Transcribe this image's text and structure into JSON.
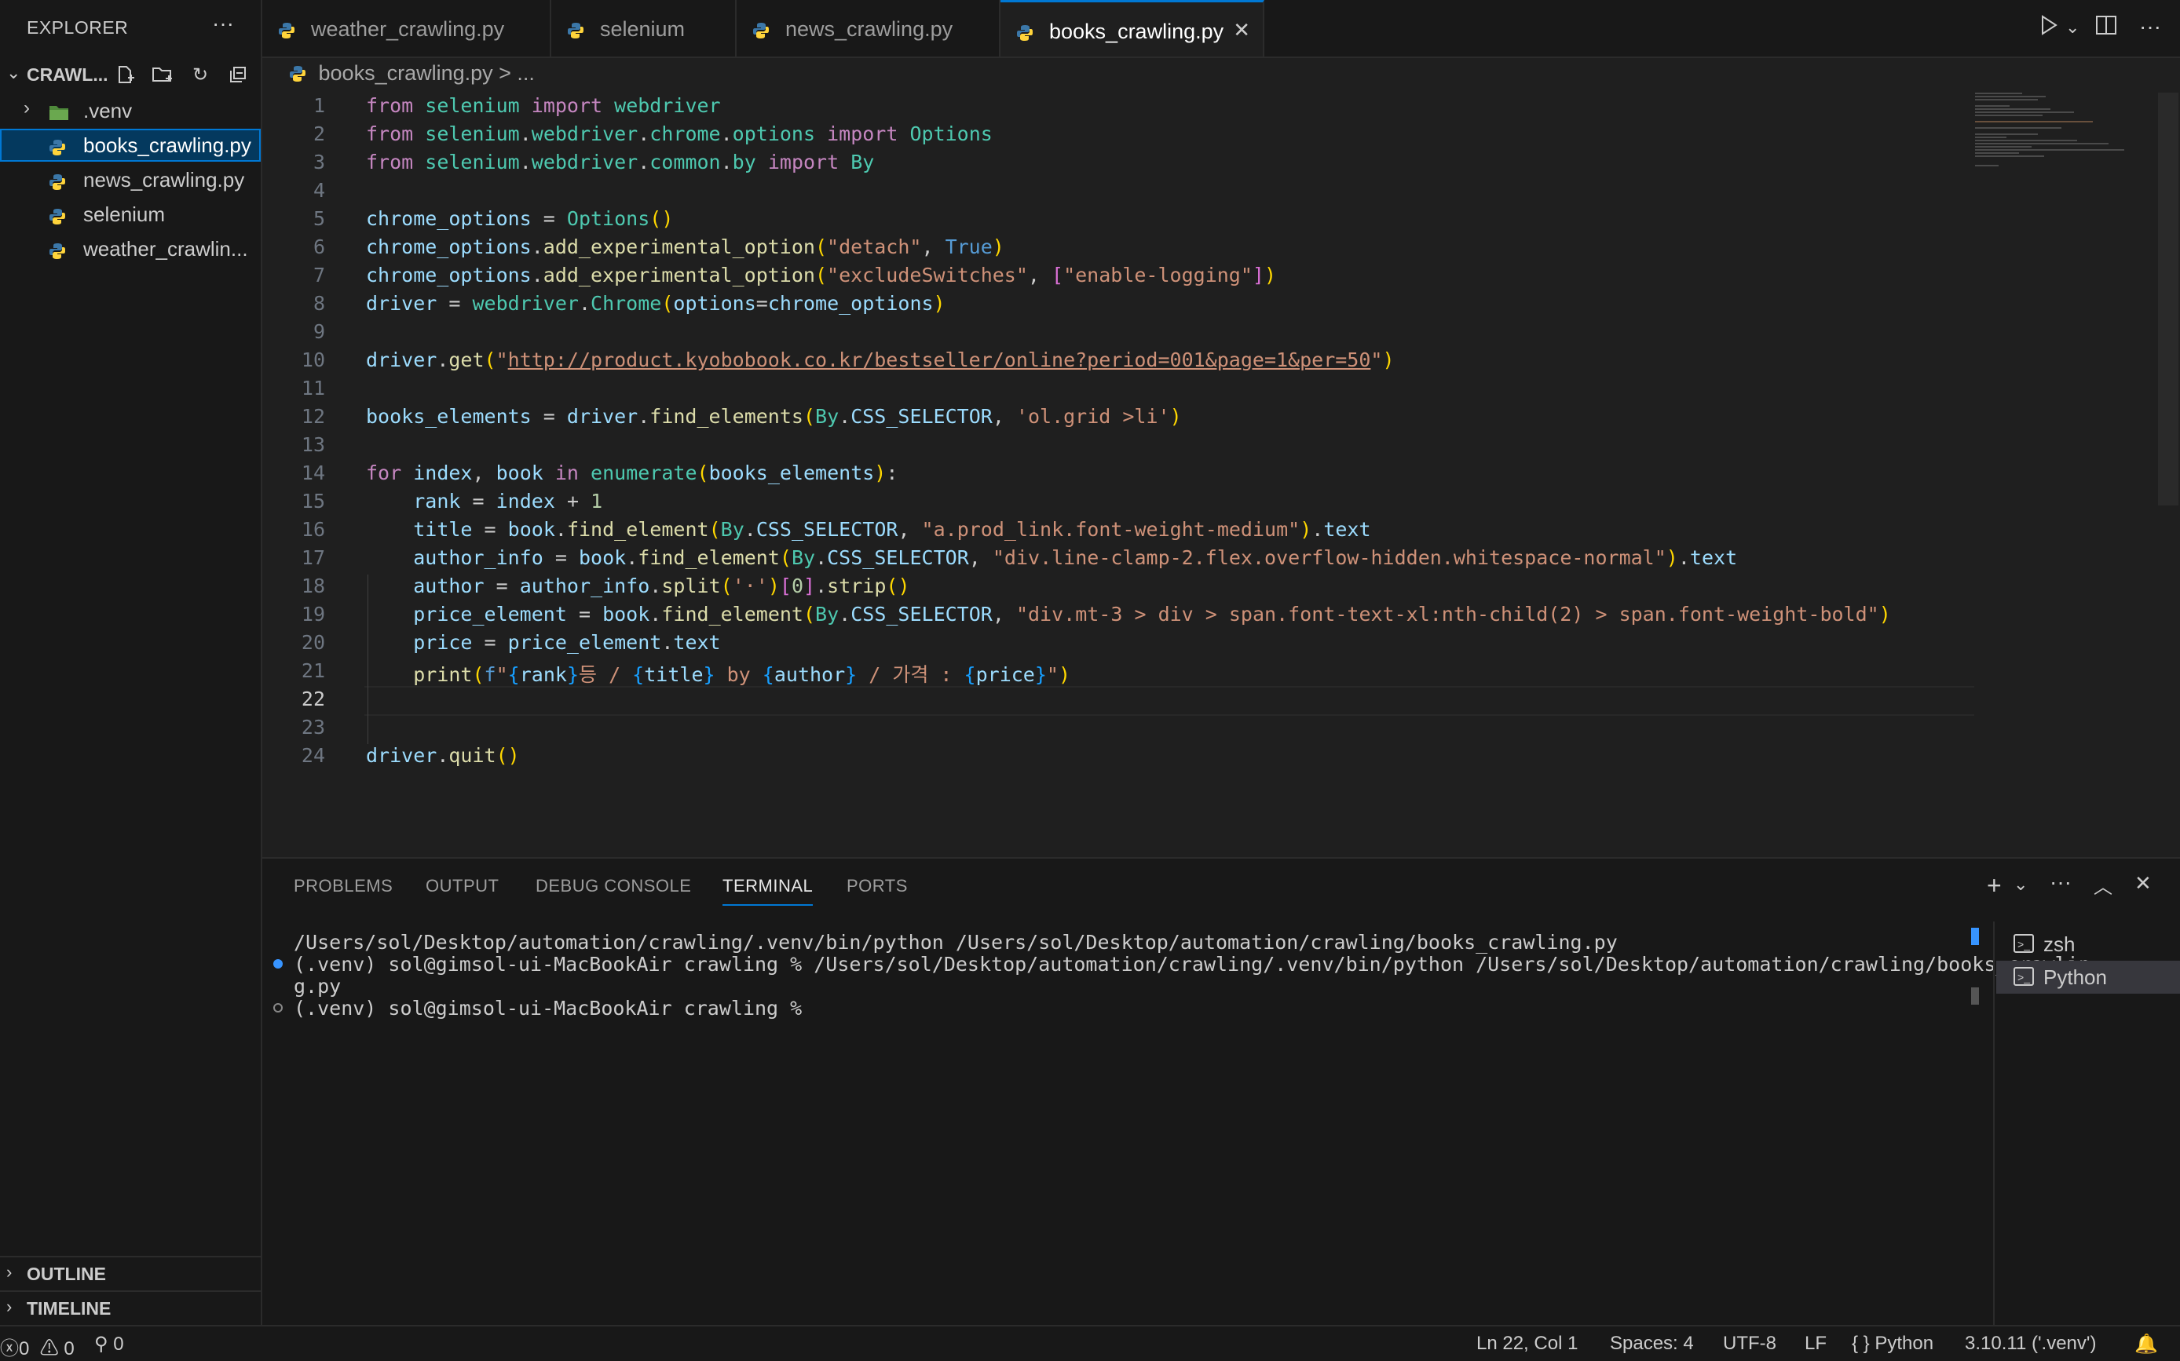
{
  "sidebar": {
    "title": "EXPLORER",
    "more": "···",
    "folder": "CRAWL...",
    "items": [
      {
        "label": ".venv"
      },
      {
        "label": "books_crawling.py"
      },
      {
        "label": "news_crawling.py"
      },
      {
        "label": "selenium"
      },
      {
        "label": "weather_crawlin..."
      }
    ],
    "outline": "OUTLINE",
    "timeline": "TIMELINE"
  },
  "tabs": [
    {
      "label": "weather_crawling.py"
    },
    {
      "label": "selenium"
    },
    {
      "label": "news_crawling.py"
    },
    {
      "label": "books_crawling.py"
    }
  ],
  "breadcrumb": {
    "file": "books_crawling.py",
    "rest": "> ..."
  },
  "editor": {
    "line_numbers": [
      "1",
      "2",
      "3",
      "4",
      "5",
      "6",
      "7",
      "8",
      "9",
      "10",
      "11",
      "12",
      "13",
      "14",
      "15",
      "16",
      "17",
      "18",
      "19",
      "20",
      "21",
      "22",
      "23",
      "24"
    ],
    "current_line": 22
  },
  "panel": {
    "tabs": [
      "PROBLEMS",
      "OUTPUT",
      "DEBUG CONSOLE",
      "TERMINAL",
      "PORTS"
    ],
    "terminal_lines": [
      "/Users/sol/Desktop/automation/crawling/.venv/bin/python /Users/sol/Desktop/automation/crawling/books_crawling.py",
      "(.venv) sol@gimsol-ui-MacBookAir crawling % /Users/sol/Desktop/automation/crawling/.venv/bin/python /Users/sol/Desktop/automation/crawling/books_crawlin",
      "g.py",
      "(.venv) sol@gimsol-ui-MacBookAir crawling % "
    ],
    "terminals": [
      "zsh",
      "Python"
    ]
  },
  "status": {
    "errors": "0",
    "warnings": "0",
    "ports": "0",
    "position": "Ln 22, Col 1",
    "spaces": "Spaces: 4",
    "encoding": "UTF-8",
    "eol": "LF",
    "language": "Python",
    "interpreter": "3.10.11 ('.venv')"
  },
  "colors": {
    "accent": "#0078d4",
    "background": "#1f1f1f",
    "sidebar": "#181818"
  }
}
